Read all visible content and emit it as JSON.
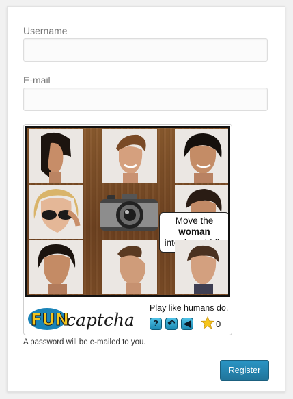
{
  "form": {
    "username_label": "Username",
    "username_value": "",
    "email_label": "E-mail",
    "email_value": "",
    "password_note": "A password will be e-mailed to you.",
    "register_label": "Register"
  },
  "captcha": {
    "instruction_line1": "Move the",
    "instruction_target": "woman",
    "instruction_line3": "into the middle",
    "tagline": "Play like humans do.",
    "logo_text_fun": "FUN",
    "logo_text_captcha": "captcha",
    "help_icon": "question-icon",
    "undo_icon": "undo-icon",
    "audio_icon": "speaker-icon",
    "score": "0",
    "colors": {
      "button": "#1c8ab4",
      "board_wood": "#7b4c26",
      "logo_yellow": "#f3c51d"
    }
  }
}
